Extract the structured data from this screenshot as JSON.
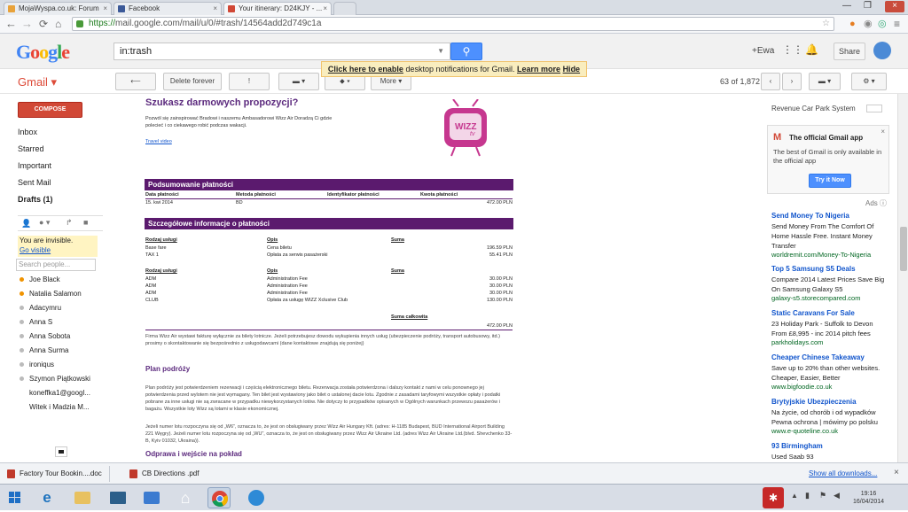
{
  "browser": {
    "tabs": [
      {
        "label": "MojaWyspa.co.uk: Forum",
        "fav": "#e8a23a"
      },
      {
        "label": "Facebook",
        "fav": "#3b5998"
      },
      {
        "label": "Your itinerary: D24KJY - ...",
        "fav": "#d14836"
      }
    ],
    "url_secure": "https://",
    "url": "mail.google.com/mail/u/0/#trash/14564add2d749c1a"
  },
  "gmail": {
    "logo": "Google",
    "search_value": "in:trash",
    "user": "+Ewa",
    "share": "Share",
    "notification": {
      "link1": "Click here to enable",
      "text": " desktop notifications for Gmail.",
      "link2": "Learn more",
      "link3": "Hide"
    },
    "brand": "Gmail ▾",
    "toolbar": {
      "back": "⟵",
      "delete": "Delete forever",
      "report": "!",
      "move": "▾",
      "labels": "▾",
      "more": "More ▾"
    },
    "count": "63 of 1,872",
    "compose": "COMPOSE",
    "nav": [
      "Inbox",
      "Starred",
      "Important",
      "Sent Mail",
      "Drafts (1)"
    ],
    "invisible": {
      "text": "You are invisible.",
      "link": "Go visible"
    },
    "people_placeholder": "Search people...",
    "contacts": [
      {
        "name": "Joe Black",
        "color": "#f09300"
      },
      {
        "name": "Natalia Salamon",
        "color": "#f09300"
      },
      {
        "name": "Adacymru",
        "color": "#bbbbbb"
      },
      {
        "name": "Anna S",
        "color": "#bbbbbb"
      },
      {
        "name": "Anna Sobota",
        "color": "#bbbbbb"
      },
      {
        "name": "Anna Surma",
        "color": "#bbbbbb"
      },
      {
        "name": "ironiqus",
        "color": "#bbbbbb"
      },
      {
        "name": "Szymon Piątkowski",
        "color": "#bbbbbb"
      },
      {
        "name": "koneffka1@googl...",
        "color": ""
      },
      {
        "name": "Witek i Madzia M...",
        "color": ""
      }
    ]
  },
  "email": {
    "promo_title": "Szukasz darmowych propozycji?",
    "promo_text1": "Pozwól się zainspirować Bradowi i naszemu Ambasadorowi Wizz Air Doradzą Ci gdzie",
    "promo_text2": "polecieć i co ciekawego robić podczas wakacji.",
    "promo_link": "Travel video",
    "tv_label": "WIZZ",
    "tv_sub": "tv",
    "payment_summary": "Podsumowanie płatności",
    "pay_headers": [
      "Data płatności",
      "Metoda płatności",
      "Identyfikator płatności",
      "Kwota płatności"
    ],
    "pay_row": [
      "15. kwi 2014",
      "BD",
      "",
      "472.00 PLN"
    ],
    "details_title": "Szczegółowe informacje o płatności",
    "service_headers": [
      "Rodzaj usługi",
      "Opis",
      "Suma"
    ],
    "services1": [
      {
        "type": "Base fare",
        "desc": "Cena biletu",
        "sum": "196.59 PLN"
      },
      {
        "type": "TAX 1",
        "desc": "Opłata za serwis pasażerski",
        "sum": "55.41 PLN"
      }
    ],
    "services2": [
      {
        "type": "ADM",
        "desc": "Administration Fee",
        "sum": "30.00 PLN"
      },
      {
        "type": "ADM",
        "desc": "Administration Fee",
        "sum": "30.00 PLN"
      },
      {
        "type": "ADM",
        "desc": "Administration Fee",
        "sum": "30.00 PLN"
      },
      {
        "type": "CLUB",
        "desc": "Opłata za usługę WIZZ Xclusive Club",
        "sum": "130.00 PLN"
      }
    ],
    "total_label": "Suma całkowita",
    "total_value": "472.00 PLN",
    "invoice_note": "Firma Wizz Air wystawi fakturę wyłącznie za bilety lotnicze. Jeżeli potrzebujesz dowodu wykupienia innych usług (ubezpieczenie podróży, transport autobusowy, itd.) prosimy o skontaktowanie się bezpośrednio z usługodawcami (dane kontaktowe znajdują się poniżej)",
    "plan_title": "Plan podróży",
    "plan_text": "Plan podróży jest potwierdzeniem rezerwacji i częścią elektronicznego biletu. Rezerwacja została potwierdzona i dalszy kontakt z nami w celu ponownego jej potwierdzenia przed wylotem nie jest wymagany. Ten bilet jest wystawiony jako bilet o ustalonej dacie lotu. Zgodnie z zasadami taryfowymi wszystkie opłaty i podatki pobrane za inne usługi nie są zwracane w przypadku niewykorzystanych lotów. Nie dotyczy to przypadków opisanych w Ogólnych warunkach przewozu pasażerów i bagażu. Wszystkie loty Wizz są lotami w klasie ekonomicznej.",
    "terminal_text": "Jeżeli numer lotu rozpoczyna się od „W6”, oznacza to, że jest on obsługiwany przez Wizz Air Hungary Kft. (adres: H-1185 Budapest, BUD International Airport Building 221 Węgry). Jeżeli numer lotu rozpoczyna się od „WU”, oznacza to, że jest on obsługiwany przez Wizz Air Ukraine Ltd. (adres Wizz Air Ukraine Ltd.(blvd. Shevchenko 33-B, Kyiv 01032, Ukraina)).",
    "checkin_title": "Odprawa i wejście na pokład"
  },
  "right": {
    "top_link": "Revenue Car Park System",
    "gmail_app_title": "The official Gmail app",
    "gmail_app_text": "The best of Gmail is only available in the official app",
    "try_btn": "Try it Now",
    "ads_label": "Ads ⓘ",
    "ads": [
      {
        "title": "Send Money To Nigeria",
        "text": "Send Money From The Comfort Of Home Hassle Free. Instant Money Transfer",
        "url": "worldremit.com/Money-To-Nigeria"
      },
      {
        "title": "Top 5 Samsung S5 Deals",
        "text": "Compare 2014 Latest Prices Save Big On Samsung Galaxy S5",
        "url": "galaxy-s5.storecompared.com"
      },
      {
        "title": "Static Caravans For Sale",
        "text": "23 Holiday Park - Suffolk to Devon From £8,995 - inc 2014 pitch fees",
        "url": "parkholidays.com"
      },
      {
        "title": "Cheaper Chinese Takeaway",
        "text": "Save up to 20% than other websites. Cheaper, Easier, Better",
        "url": "www.bigfoodie.co.uk"
      },
      {
        "title": "Brytyjskie Ubezpieczenia",
        "text": "Na życie, od chorób i od wypadków Pewna ochrona | mówimy po polsku",
        "url": "www.e-quoteline.co.uk"
      },
      {
        "title": "93 Birmingham",
        "text": "Used Saab 93",
        "url": ""
      }
    ]
  },
  "downloads": {
    "items": [
      {
        "label": "Factory Tour Bookin....doc",
        "color": "#c0392b"
      },
      {
        "label": "CB Directions .pdf",
        "color": "#c0392b"
      }
    ],
    "show_all": "Show all downloads..."
  },
  "taskbar": {
    "time": "19:16",
    "date": "16/04/2014"
  }
}
